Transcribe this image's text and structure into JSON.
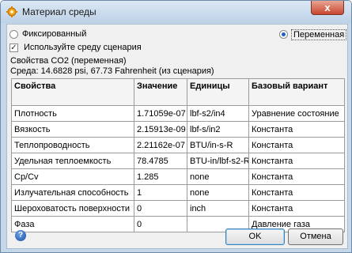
{
  "window": {
    "title": "Материал среды",
    "close_glyph": "x"
  },
  "mode": {
    "fixed_label": "Фиксированный",
    "variable_label": "Переменная",
    "selected": "variable"
  },
  "use_scenario": {
    "label": "Используйте среду сценария",
    "checked": true
  },
  "info": {
    "line1": "Свойства CO2 (переменная)",
    "line2": "Среда: 14.6828 psi, 67.73 Fahrenheit (из сценария)"
  },
  "table": {
    "headers": [
      "Свойства",
      "Значение",
      "Единицы",
      "Базовый вариант"
    ],
    "rows": [
      [
        "Плотность",
        "1.71059e-07",
        "lbf-s2/in4",
        "Уравнение состояние"
      ],
      [
        "Вязкость",
        "2.15913e-09",
        "lbf-s/in2",
        "Константа"
      ],
      [
        "Теплопроводность",
        "2.21162e-07",
        "BTU/in-s-R",
        "Константа"
      ],
      [
        "Удельная теплоемкость",
        "78.4785",
        "BTU-in/lbf-s2-R",
        "Константа"
      ],
      [
        "Cp/Cv",
        "1.285",
        "none",
        "Константа"
      ],
      [
        "Излучательная способность",
        "1",
        "none",
        "Константа"
      ],
      [
        "Шероховатость поверхности",
        "0",
        "inch",
        "Константа"
      ],
      [
        "Фаза",
        "0",
        "",
        "Давление газа"
      ]
    ]
  },
  "buttons": {
    "ok": "OK",
    "cancel": "Отмена",
    "help_glyph": "?"
  },
  "colors": {
    "accent": "#1e5fbf",
    "close": "#c9462f"
  }
}
